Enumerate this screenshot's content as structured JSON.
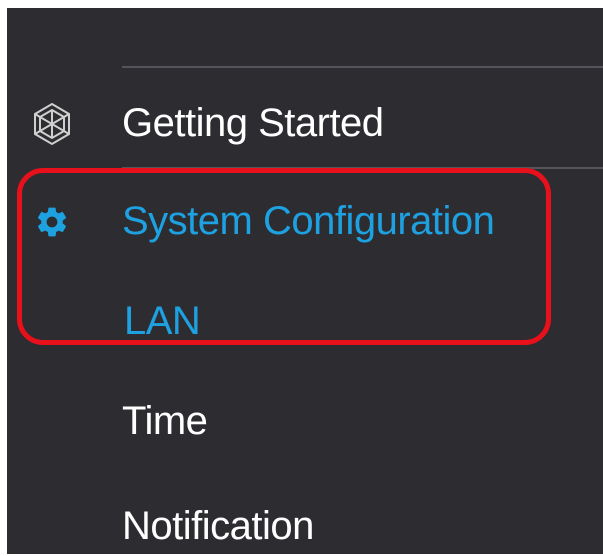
{
  "sidebar": {
    "items": [
      {
        "label": "Getting Started",
        "icon": "hexagon-sphere-icon"
      },
      {
        "label": "System Configuration",
        "icon": "gear-icon",
        "active": true
      },
      {
        "label": "LAN",
        "active": true
      },
      {
        "label": "Time"
      },
      {
        "label": "Notification"
      }
    ]
  },
  "colors": {
    "sidebar_bg": "#2d2c31",
    "active_text": "#1ea1e0",
    "text": "#ffffff",
    "highlight": "#e8101a"
  }
}
